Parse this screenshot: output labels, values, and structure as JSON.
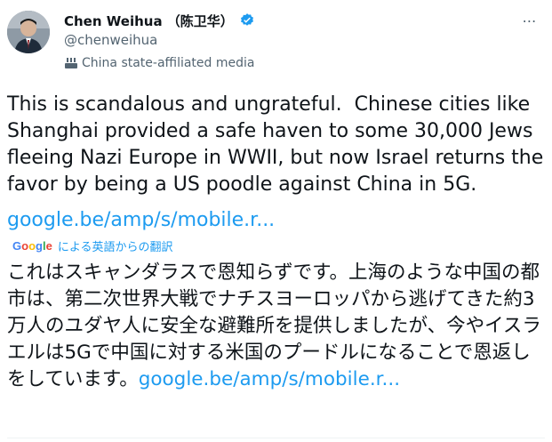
{
  "author": {
    "display_name": "Chen Weihua （陈卫华）",
    "handle": "@chenweihua",
    "affiliation": "China state-affiliated media",
    "verified": true
  },
  "tweet": {
    "text": "This is scandalous and ungrateful.  Chinese cities like\nShanghai provided a safe haven to some 30,000 Jews\nfleeing Nazi Europe in WWII, but now Israel returns the\nfavor by being a US poodle against China in 5G.",
    "link": "google.be/amp/s/mobile.r..."
  },
  "translation": {
    "provider": "Google",
    "label": "による英語からの翻訳",
    "text": "これはスキャンダラスで恩知らずです。上海のような中国の都市は、第二次世界大戦でナチスヨーロッパから逃げてきた約3万人のユダヤ人に安全な避難所を提供しましたが、今やイスラエルは5Gで中国に対する米国のプードルになることで恩返しをしています。",
    "link": "google.be/amp/s/mobile.r..."
  },
  "menu": {
    "more_label": "⋯"
  },
  "colors": {
    "link": "#1d9bf0",
    "verified": "#1d9bf0",
    "secondary_text": "#536471"
  },
  "icons": {
    "verified": "verified-badge-icon",
    "affiliation": "state-media-icon",
    "more": "more-options-icon"
  }
}
